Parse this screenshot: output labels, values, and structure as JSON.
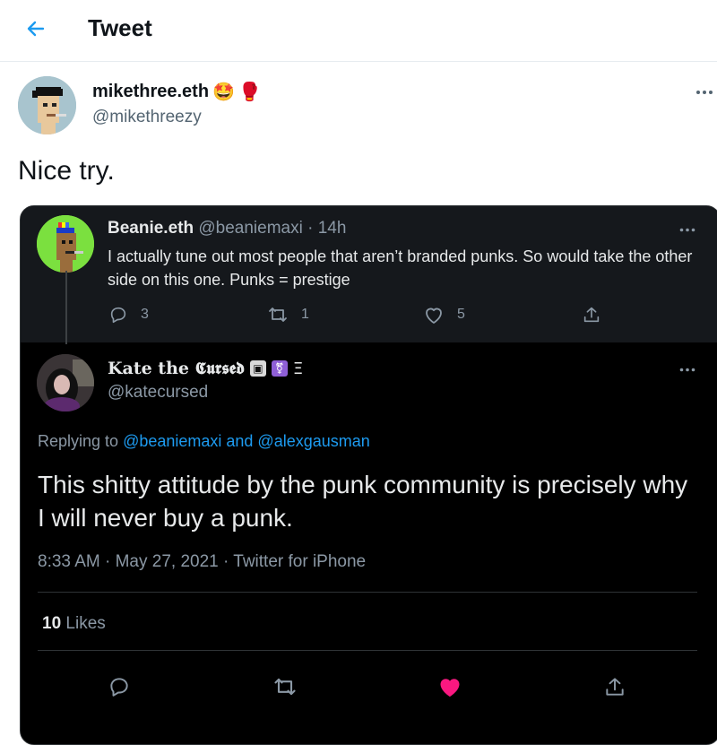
{
  "header": {
    "title": "Tweet"
  },
  "tweet": {
    "display_name": "mikethree.eth",
    "name_emojis": [
      "🤩",
      "🥊"
    ],
    "handle": "@mikethreezy",
    "text": "Nice try."
  },
  "quoted_thread": {
    "parent": {
      "display_name": "Beanie.eth",
      "handle_time": "@beaniemaxi · 14h",
      "text": "I actually tune out most people that aren’t branded punks. So would take the other side on this one. Punks = prestige",
      "replies": "3",
      "retweets": "1",
      "likes": "5"
    },
    "reply": {
      "display_name": "Kate the 𝕮𝖚𝖗𝖘𝖊𝖉",
      "name_suffix": "Ξ",
      "handle": "@katecursed",
      "replying_prefix": "Replying to ",
      "replying_to": "@beaniemaxi and @alexgausman",
      "text": "This shitty attitude by the punk community is precisely why I will never buy a punk.",
      "timestamp": "8:33 AM · May 27, 2021 · Twitter for iPhone",
      "likes_count": "10",
      "likes_label": "Likes"
    }
  },
  "colors": {
    "accent": "#1d9bf0",
    "like_red": "#f91880",
    "dark_bg": "#000000"
  }
}
